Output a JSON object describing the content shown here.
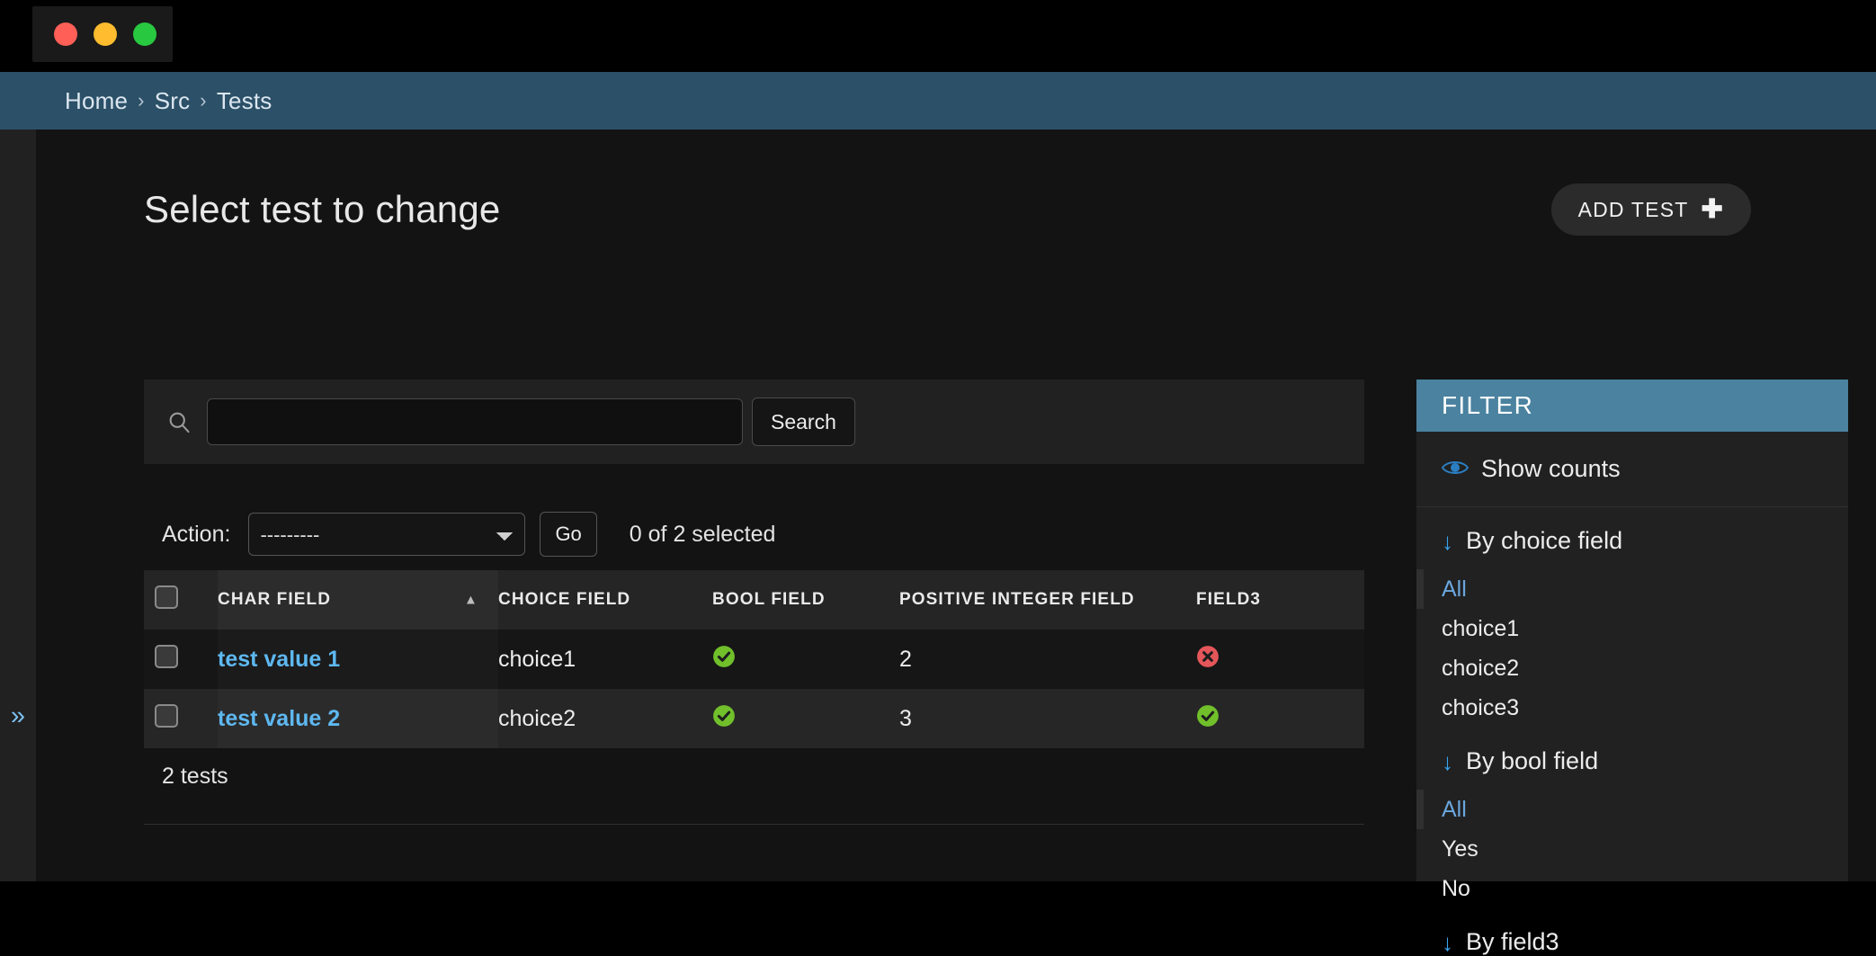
{
  "window": {
    "traffic_lights": [
      "close-red",
      "minimize-yellow",
      "maximize-green"
    ]
  },
  "breadcrumb": {
    "items": [
      "Home",
      "Src",
      "Tests"
    ],
    "separator": "›"
  },
  "header": {
    "title": "Select test to change",
    "add_button_label": "ADD TEST",
    "add_button_icon": "plus-icon"
  },
  "search": {
    "icon": "search-icon",
    "value": "",
    "placeholder": "",
    "button_label": "Search"
  },
  "actions": {
    "label": "Action:",
    "selected": "---------",
    "options": [
      "---------"
    ],
    "go_label": "Go",
    "selection_status": "0 of 2 selected"
  },
  "table": {
    "columns": [
      {
        "key": "check",
        "label": "",
        "sorted": false
      },
      {
        "key": "char",
        "label": "CHAR FIELD",
        "sorted": true,
        "sort_dir": "asc",
        "sort_caret": "▲"
      },
      {
        "key": "choice",
        "label": "CHOICE FIELD",
        "sorted": false
      },
      {
        "key": "bool",
        "label": "BOOL FIELD",
        "sorted": false
      },
      {
        "key": "int",
        "label": "POSITIVE INTEGER FIELD",
        "sorted": false
      },
      {
        "key": "field3",
        "label": "FIELD3",
        "sorted": false
      }
    ],
    "rows": [
      {
        "selected": false,
        "char_field": "test value 1",
        "choice_field": "choice1",
        "bool_field": "yes",
        "positive_integer_field": "2",
        "field3": "no"
      },
      {
        "selected": false,
        "char_field": "test value 2",
        "choice_field": "choice2",
        "bool_field": "yes",
        "positive_integer_field": "3",
        "field3": "yes"
      }
    ],
    "result_count": "2 tests"
  },
  "filter": {
    "title": "FILTER",
    "show_counts_label": "Show counts",
    "show_counts_icon": "eye-icon",
    "groups": [
      {
        "title": "By choice field",
        "icon": "down-arrow-icon",
        "options": [
          {
            "label": "All",
            "selected": true
          },
          {
            "label": "choice1",
            "selected": false
          },
          {
            "label": "choice2",
            "selected": false
          },
          {
            "label": "choice3",
            "selected": false
          }
        ]
      },
      {
        "title": "By bool field",
        "icon": "down-arrow-icon",
        "options": [
          {
            "label": "All",
            "selected": true
          },
          {
            "label": "Yes",
            "selected": false
          },
          {
            "label": "No",
            "selected": false
          }
        ]
      },
      {
        "title": "By field3",
        "icon": "down-arrow-icon",
        "options": []
      }
    ]
  },
  "nav": {
    "toggle_icon": "chevron-double-right-icon",
    "toggle_label": "»"
  },
  "colors": {
    "breadcrumb_bar": "#2b5068",
    "filter_header": "#4a82a0",
    "link": "#5eb8f0",
    "accent_blue": "#37a4ef",
    "success_green": "#70bf2b",
    "error_red": "#e4565a",
    "page_bg": "#131313",
    "panel_bg": "#212121"
  }
}
